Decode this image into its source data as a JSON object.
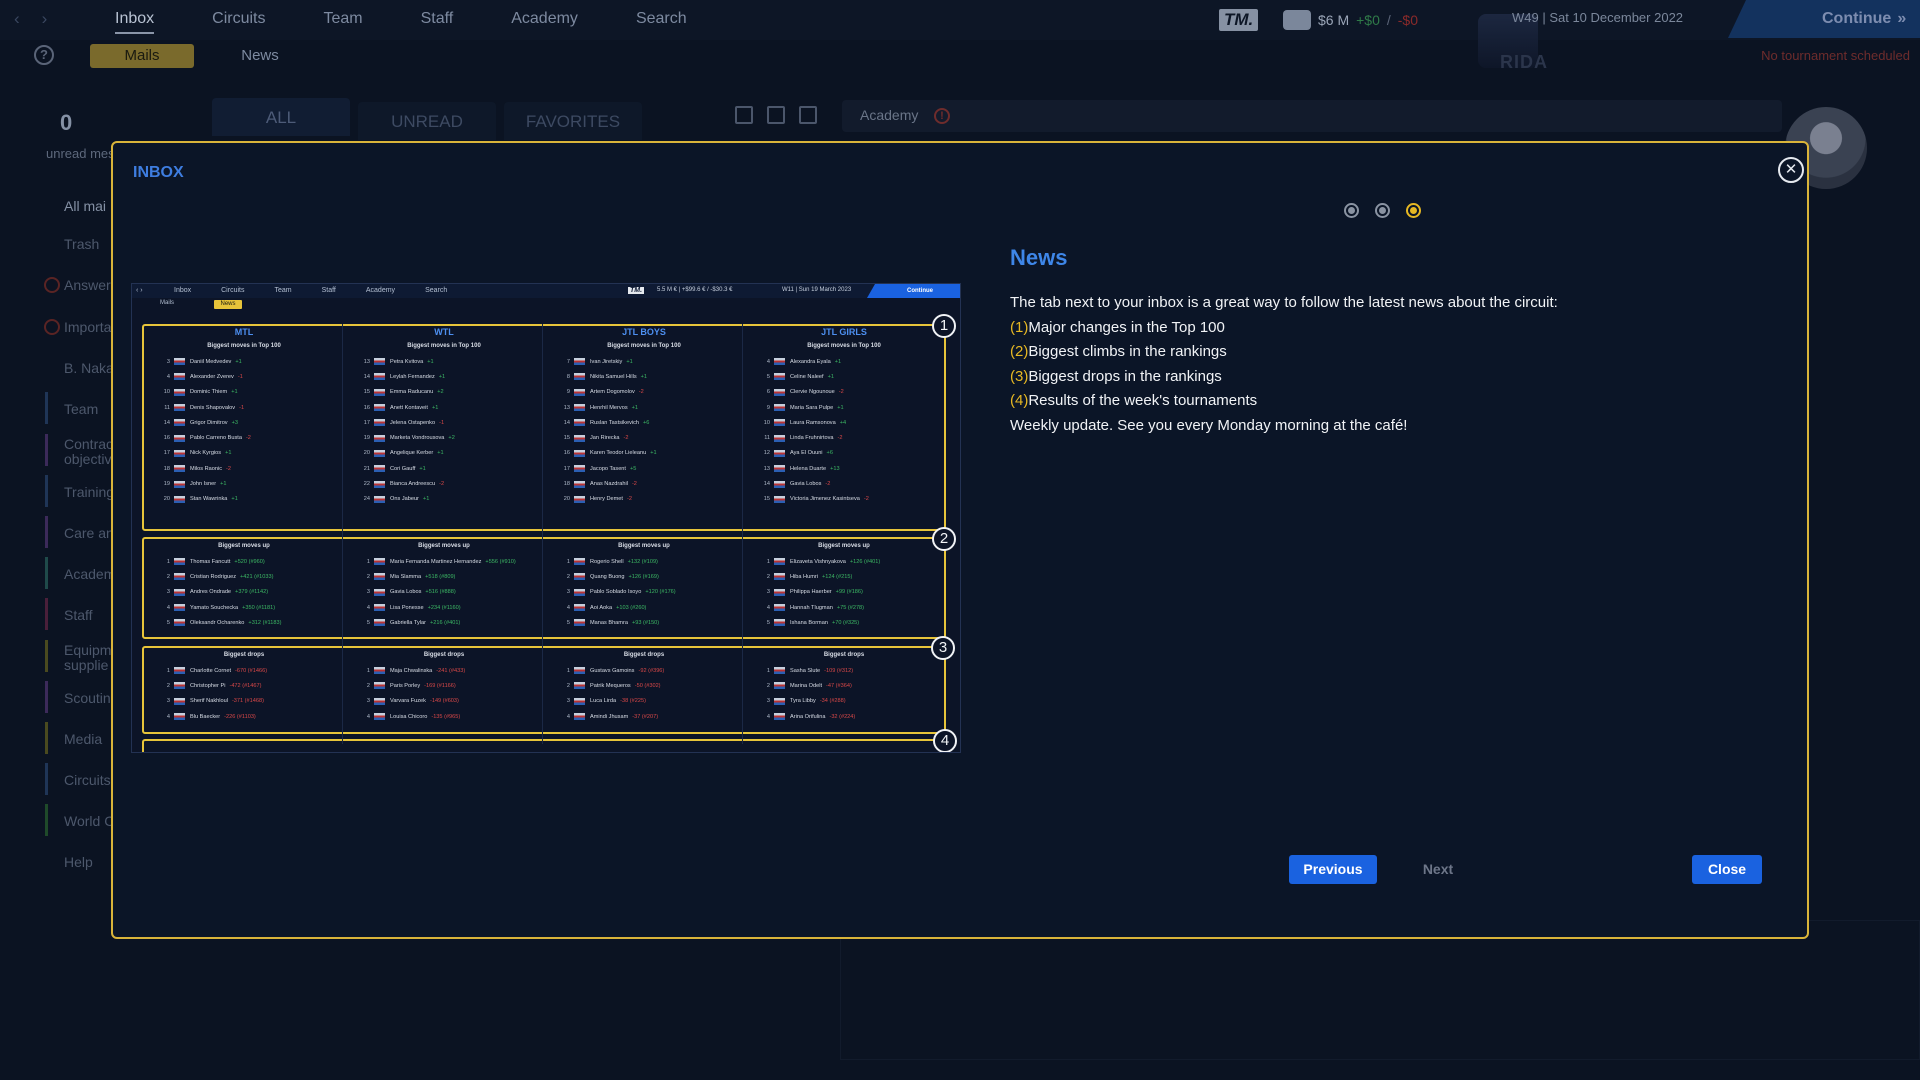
{
  "topnav": {
    "back": "‹",
    "forward": "›",
    "tabs": [
      "Inbox",
      "Circuits",
      "Team",
      "Staff",
      "Academy",
      "Search"
    ],
    "logo": "TM.",
    "money": "$6 M",
    "money_up": "+$0",
    "money_sep": "/",
    "money_down": "-$0",
    "date": "W49 | Sat 10 December 2022",
    "continue": "Continue",
    "crest_text": "RIDA"
  },
  "subnav": {
    "help": "?",
    "mails": "Mails",
    "news": "News",
    "no_tournament": "No tournament scheduled"
  },
  "inbox_bg": {
    "unread_count": "0",
    "unread_label": "unread mes",
    "filters": [
      "ALL",
      "UNREAD",
      "FAVORITES"
    ],
    "academy": "Academy",
    "alert": "!",
    "sidebar": [
      "All mai",
      "Trash",
      "Answer",
      "Importa",
      "B. Naka",
      "Team",
      "Contrac",
      "objectiv",
      "Training",
      "Care an",
      "Academ",
      "Staff",
      "Equipm",
      "supplie",
      "Scoutin",
      "Media",
      "Circuits",
      "World C",
      "Help"
    ]
  },
  "modal": {
    "title": "INBOX",
    "close_x": "✕",
    "heading": "News",
    "intro": "The tab next to your inbox is a great way to follow the latest news about the circuit:",
    "items": [
      {
        "num": "(1)",
        "text": "Major changes in the Top 100"
      },
      {
        "num": "(2)",
        "text": "Biggest climbs in the rankings"
      },
      {
        "num": "(3)",
        "text": "Biggest drops in the rankings"
      },
      {
        "num": "(4)",
        "text": "Results of the week's tournaments"
      }
    ],
    "outro": "Weekly update. See you every Monday morning at the café!",
    "buttons": {
      "previous": "Previous",
      "next": "Next",
      "close": "Close"
    },
    "colors": {
      "accent": "#e7b823",
      "heading": "#3e86e8",
      "button": "#1a62e0"
    }
  },
  "screenshot": {
    "nav": [
      "Inbox",
      "Circuits",
      "Team",
      "Staff",
      "Academy",
      "Search"
    ],
    "logo": "TM.",
    "money": "5.5 M € | +$99.6 € / -$30.3 €",
    "date": "W11 | Sun 19 March 2023",
    "continue": "Continue",
    "mails": "Mails",
    "news": "News",
    "badges": [
      "1",
      "2",
      "3",
      "4"
    ],
    "columns": [
      {
        "head": "MTL",
        "top_title": "Biggest moves in Top 100",
        "top": [
          [
            "3",
            "Daniil Medvedev",
            "+1"
          ],
          [
            "4",
            "Alexander Zverev",
            "-1"
          ],
          [
            "10",
            "Dominic Thiem",
            "+1"
          ],
          [
            "11",
            "Denis Shapovalov",
            "-1"
          ],
          [
            "14",
            "Grigor Dimitrov",
            "+3"
          ],
          [
            "16",
            "Pablo Carreno Busta",
            "-2"
          ],
          [
            "17",
            "Nick Kyrgios",
            "+1"
          ],
          [
            "18",
            "Milos Raonic",
            "-2"
          ],
          [
            "19",
            "John Isner",
            "+1"
          ],
          [
            "20",
            "Stan Wawrinka",
            "+1"
          ]
        ],
        "up_title": "Biggest moves up",
        "up": [
          [
            "1",
            "Thomas Fancutt",
            "+520 (#960)"
          ],
          [
            "2",
            "Cristian Rodriguez",
            "+421 (#1033)"
          ],
          [
            "3",
            "Andres Ondrade",
            "+379 (#1142)"
          ],
          [
            "4",
            "Yamato Souchecka",
            "+350 (#1181)"
          ],
          [
            "5",
            "Oleksandr Ocharenko",
            "+312 (#1183)"
          ]
        ],
        "down_title": "Biggest drops",
        "down": [
          [
            "1",
            "Charlotte Cornet",
            "-670 (#1466)"
          ],
          [
            "2",
            "Christopher Pi",
            "-472 (#1467)"
          ],
          [
            "3",
            "Sherif Nakhloul",
            "-371 (#1468)"
          ],
          [
            "4",
            "Blu Baecker",
            "-226 (#1103)"
          ]
        ]
      },
      {
        "head": "WTL",
        "top_title": "Biggest moves in Top 100",
        "top": [
          [
            "13",
            "Petra Kvitova",
            "+1"
          ],
          [
            "14",
            "Leylah Fernandez",
            "+1"
          ],
          [
            "15",
            "Emma Raducanu",
            "+2"
          ],
          [
            "16",
            "Anett Kontaveit",
            "+1"
          ],
          [
            "17",
            "Jelena Ostapenko",
            "-1"
          ],
          [
            "19",
            "Marketa Vondrousova",
            "+2"
          ],
          [
            "20",
            "Angelique Kerber",
            "+1"
          ],
          [
            "21",
            "Cori Gauff",
            "+1"
          ],
          [
            "22",
            "Bianca Andreescu",
            "-2"
          ],
          [
            "24",
            "Ons Jabeur",
            "+1"
          ]
        ],
        "up_title": "Biggest moves up",
        "up": [
          [
            "1",
            "Maria Fernanda Martinez Hernandez",
            "+556 (#910)"
          ],
          [
            "2",
            "Mia Slamma",
            "+518 (#809)"
          ],
          [
            "3",
            "Gavia Lobos",
            "+516 (#888)"
          ],
          [
            "4",
            "Lisa Ponesse",
            "+234 (#1160)"
          ],
          [
            "5",
            "Gabriella Tylar",
            "+216 (#401)"
          ]
        ],
        "down_title": "Biggest drops",
        "down": [
          [
            "1",
            "Maja Chwalinska",
            "-241 (#433)"
          ],
          [
            "2",
            "Paris Porley",
            "-169 (#1166)"
          ],
          [
            "3",
            "Varvara Fuzek",
            "-149 (#603)"
          ],
          [
            "4",
            "Louisa Chicoro",
            "-135 (#965)"
          ]
        ]
      },
      {
        "head": "JTL BOYS",
        "top_title": "Biggest moves in Top 100",
        "top": [
          [
            "7",
            "Ivan Jiretskiy",
            "+1"
          ],
          [
            "8",
            "Nikita Samuel Hills",
            "+1"
          ],
          [
            "9",
            "Artem Dogomolov",
            "-2"
          ],
          [
            "13",
            "Henrhil Mervos",
            "+1"
          ],
          [
            "14",
            "Ruslan Tastsikevich",
            "+6"
          ],
          [
            "15",
            "Jan Rirecka",
            "-2"
          ],
          [
            "16",
            "Karen Teodor Lieleanu",
            "+1"
          ],
          [
            "17",
            "Jacopo Tasent",
            "+5"
          ],
          [
            "18",
            "Anas Nazdrahil",
            "-2"
          ],
          [
            "20",
            "Henry Demet",
            "-2"
          ]
        ],
        "up_title": "Biggest moves up",
        "up": [
          [
            "1",
            "Rogerio Shell",
            "+132 (#109)"
          ],
          [
            "2",
            "Quang Buong",
            "+126 (#169)"
          ],
          [
            "3",
            "Pablo Soblado Isoyo",
            "+120 (#176)"
          ],
          [
            "4",
            "Aoi Aoka",
            "+103 (#260)"
          ],
          [
            "5",
            "Manas Bhamra",
            "+93 (#150)"
          ]
        ],
        "down_title": "Biggest drops",
        "down": [
          [
            "1",
            "Gustavs Gamoins",
            "-92 (#396)"
          ],
          [
            "2",
            "Patrik Mequeros",
            "-50 (#302)"
          ],
          [
            "3",
            "Luca Lirda",
            "-38 (#225)"
          ],
          [
            "4",
            "Amindi Jhusam",
            "-37 (#207)"
          ]
        ]
      },
      {
        "head": "JTL GIRLS",
        "top_title": "Biggest moves in Top 100",
        "top": [
          [
            "4",
            "Alexandra Eyala",
            "+1"
          ],
          [
            "5",
            "Celine Naleef",
            "+1"
          ],
          [
            "6",
            "Clervie Ngounoue",
            "-2"
          ],
          [
            "9",
            "Maria Sara Pulpe",
            "+1"
          ],
          [
            "10",
            "Laura Ramsonova",
            "+4"
          ],
          [
            "11",
            "Linda Fruhnirtova",
            "-2"
          ],
          [
            "12",
            "Aya El Ouuni",
            "+6"
          ],
          [
            "13",
            "Helena Duarte",
            "+13"
          ],
          [
            "14",
            "Gavia Lobos",
            "-2"
          ],
          [
            "15",
            "Victoria Jimenez Kasintseva",
            "-2"
          ]
        ],
        "up_title": "Biggest moves up",
        "up": [
          [
            "1",
            "Elizaveta Vishnyakova",
            "+126 (#401)"
          ],
          [
            "2",
            "Hiba Humri",
            "+124 (#215)"
          ],
          [
            "3",
            "Philippa Haerber",
            "+99 (#186)"
          ],
          [
            "4",
            "Hannah Tlugman",
            "+75 (#278)"
          ],
          [
            "5",
            "Ishana Borman",
            "+70 (#325)"
          ]
        ],
        "down_title": "Biggest drops",
        "down": [
          [
            "1",
            "Sasha Slute",
            "-109 (#312)"
          ],
          [
            "2",
            "Marina Odelt",
            "-47 (#364)"
          ],
          [
            "3",
            "Tyra Libby",
            "-34 (#288)"
          ],
          [
            "4",
            "Arina Orifulina",
            "-32 (#224)"
          ]
        ]
      }
    ]
  }
}
